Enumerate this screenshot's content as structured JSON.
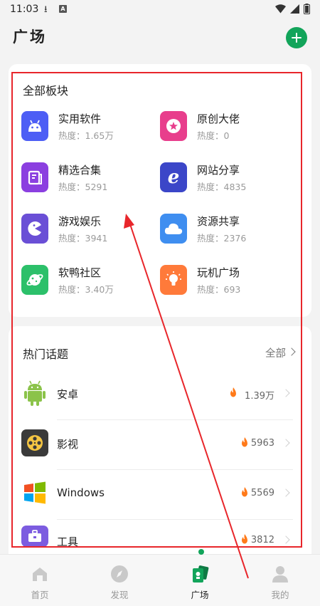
{
  "status_bar": {
    "time": "11:03"
  },
  "header": {
    "title": "广场"
  },
  "boards": {
    "title": "全部板块",
    "items": [
      {
        "name": "实用软件",
        "heat": "热度：1.65万",
        "icon": "android-icon",
        "color": "#4d5ef5"
      },
      {
        "name": "原创大佬",
        "heat": "热度：0",
        "icon": "star-badge-icon",
        "color": "#e83e8c"
      },
      {
        "name": "精选合集",
        "heat": "热度：5291",
        "icon": "collection-icon",
        "color": "#8b3fe0"
      },
      {
        "name": "网站分享",
        "heat": "热度：4835",
        "icon": "ie-browser-icon",
        "color": "#3b46c8"
      },
      {
        "name": "游戏娱乐",
        "heat": "热度：3941",
        "icon": "pacman-icon",
        "color": "#6a4fd6"
      },
      {
        "name": "资源共享",
        "heat": "热度：2376",
        "icon": "cloud-icon",
        "color": "#3f8ef0"
      },
      {
        "name": "软鸭社区",
        "heat": "热度：3.40万",
        "icon": "planet-icon",
        "color": "#2cc06a"
      },
      {
        "name": "玩机广场",
        "heat": "热度：693",
        "icon": "bulb-icon",
        "color": "#ff7a3a"
      }
    ]
  },
  "topics": {
    "title": "热门话题",
    "all_label": "全部",
    "items": [
      {
        "name": "安卓",
        "count": "1.39万",
        "icon": "android-robot-icon"
      },
      {
        "name": "影视",
        "count": "5963",
        "icon": "film-reel-icon"
      },
      {
        "name": "Windows",
        "count": "5569",
        "icon": "windows-logo-icon"
      },
      {
        "name": "工具",
        "count": "3812",
        "icon": "toolbox-icon"
      }
    ]
  },
  "bottom_nav": {
    "items": [
      {
        "label": "首页",
        "icon": "home-icon"
      },
      {
        "label": "发现",
        "icon": "compass-icon"
      },
      {
        "label": "广场",
        "icon": "plaza-icon",
        "active": true
      },
      {
        "label": "我的",
        "icon": "profile-icon"
      }
    ]
  },
  "colors": {
    "accent": "#12a45a",
    "annotation": "#e8262b"
  }
}
